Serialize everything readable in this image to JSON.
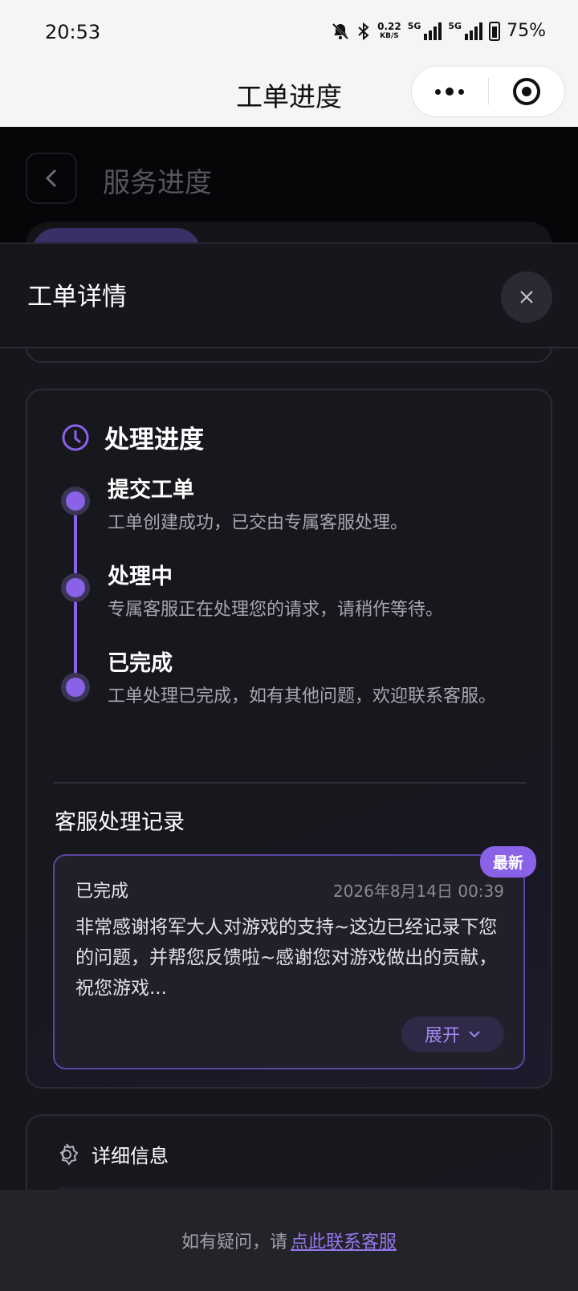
{
  "status_bar": {
    "time": "20:53",
    "net_speed_value": "0.22",
    "net_speed_unit": "KB/S",
    "sim1": "5G",
    "sim2": "5G",
    "battery": "75%"
  },
  "navbar": {
    "title": "工单进度"
  },
  "background_page": {
    "title": "服务进度"
  },
  "sheet": {
    "title": "工单详情"
  },
  "progress": {
    "heading": "处理进度",
    "steps": [
      {
        "title": "提交工单",
        "desc": "工单创建成功，已交由专属客服处理。"
      },
      {
        "title": "处理中",
        "desc": "专属客服正在处理您的请求，请稍作等待。"
      },
      {
        "title": "已完成",
        "desc": "工单处理已完成，如有其他问题，欢迎联系客服。"
      }
    ]
  },
  "records": {
    "heading": "客服处理记录",
    "items": [
      {
        "badge": "最新",
        "status": "已完成",
        "time": "2026年8月14日 00:39",
        "content": "非常感谢将军大人对游戏的支持~这边已经记录下您的问题，并帮您反馈啦~感谢您对游戏做出的贡献，祝您游戏...",
        "expand_label": "展开"
      }
    ]
  },
  "details": {
    "heading": "详细信息"
  },
  "footer": {
    "prefix": "如有疑问，请",
    "link": "点此联系客服"
  },
  "colors": {
    "accent": "#8a62e8",
    "background": "#16161d",
    "link": "#9677ec"
  }
}
